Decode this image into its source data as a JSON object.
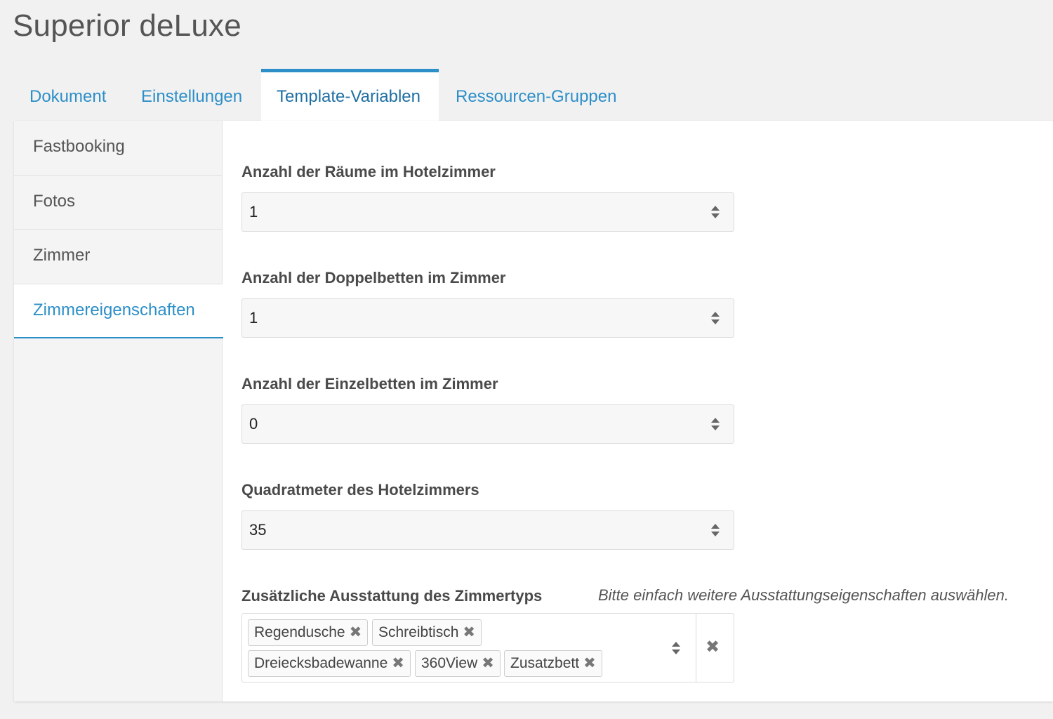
{
  "page": {
    "title": "Superior deLuxe"
  },
  "tabs": [
    {
      "label": "Dokument"
    },
    {
      "label": "Einstellungen"
    },
    {
      "label": "Template-Variablen",
      "active": true
    },
    {
      "label": "Ressourcen-Gruppen"
    }
  ],
  "sidebar": {
    "items": [
      {
        "label": "Fastbooking"
      },
      {
        "label": "Fotos"
      },
      {
        "label": "Zimmer"
      },
      {
        "label": "Zimmereigenschaften",
        "active": true
      }
    ]
  },
  "fields": [
    {
      "label": "Anzahl der Räume im Hotelzimmer",
      "value": "1",
      "icon": "updown-arrows-icon"
    },
    {
      "label": "Anzahl der Doppelbetten im Zimmer",
      "value": "1",
      "icon": "updown-arrows-icon"
    },
    {
      "label": "Anzahl der Einzelbetten im Zimmer",
      "value": "0",
      "icon": "updown-arrows-icon"
    },
    {
      "label": "Quadratmeter des Hotelzimmers",
      "value": "35",
      "icon": "updown-arrows-icon"
    }
  ],
  "equipment": {
    "label": "Zusätzliche Ausstattung des Zimmertyps",
    "hint": "Bitte einfach weitere Ausstattungseigenschaften auswählen.",
    "tags": [
      "Regendusche",
      "Schreibtisch",
      "Dreiecksbadewanne",
      "360View",
      "Zusatzbett"
    ],
    "remove_glyph": "✖",
    "clear_glyph": "✖"
  },
  "colors": {
    "accent": "#2d8fc8",
    "background": "#f1f1f1",
    "panel": "#ffffff"
  }
}
